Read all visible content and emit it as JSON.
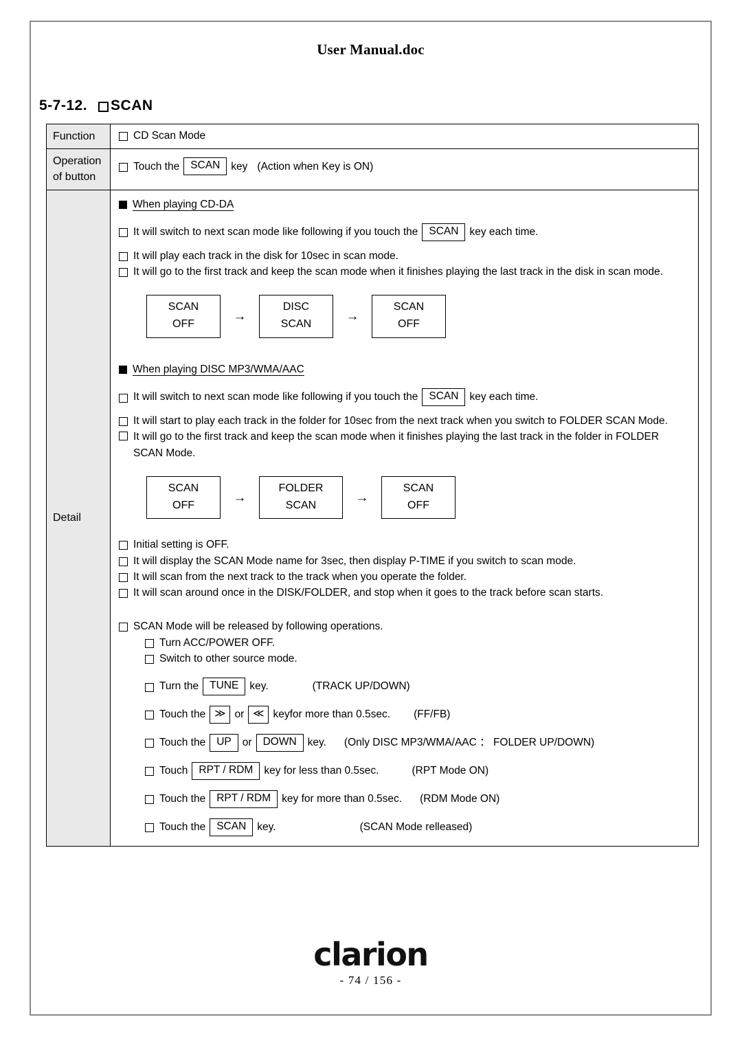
{
  "header": {
    "title": "User Manual.doc"
  },
  "section": {
    "number": "5-7-12.",
    "title": "SCAN"
  },
  "table": {
    "labels": {
      "function": "Function",
      "operation_line1": "Operation",
      "operation_line2": "of button",
      "detail": "Detail"
    },
    "function_row": {
      "text": "CD Scan Mode"
    },
    "operation_row": {
      "prefix": "Touch the",
      "key": "SCAN",
      "suffix": "key",
      "note": "(Action when Key is ON)"
    },
    "detail": {
      "cdda": {
        "heading": "When playing CD-DA",
        "b1_pre": "It will switch to next scan mode like following if you touch the",
        "b1_key": "SCAN",
        "b1_post": "key each time.",
        "b2": "It will play each track in the disk for 10sec in scan mode.",
        "b3": "It will go to the first track and keep the scan mode when it finishes playing the last track in the disk in scan mode.",
        "flow": [
          {
            "line1": "SCAN",
            "line2": "OFF"
          },
          {
            "line1": "DISC",
            "line2": "SCAN"
          },
          {
            "line1": "SCAN",
            "line2": "OFF"
          }
        ],
        "arrow": "→"
      },
      "mp3": {
        "heading": "When playing DISC MP3/WMA/AAC",
        "b1_pre": "It will switch to next scan mode like following if you touch the",
        "b1_key": "SCAN",
        "b1_post": "key each time.",
        "b2": "It will start to play each track in the folder for 10sec from the next track when you switch to FOLDER SCAN Mode.",
        "b3": "It will go to the first track and keep the scan mode when it finishes playing the last track in the folder in FOLDER SCAN Mode.",
        "flow": [
          {
            "line1": "SCAN",
            "line2": "OFF"
          },
          {
            "line1": "FOLDER",
            "line2": "SCAN"
          },
          {
            "line1": "SCAN",
            "line2": "OFF"
          }
        ],
        "arrow": "→"
      },
      "notes": [
        "Initial setting is OFF.",
        "It will display the SCAN Mode name for 3sec, then display P-TIME if you switch to scan mode.",
        "It will scan from the next track to the track when you operate the folder.",
        "It will scan around once in the DISK/FOLDER, and stop when it goes to the track before scan starts."
      ],
      "release": {
        "heading": "SCAN Mode will be released by following operations.",
        "simple": [
          "Turn ACC/POWER OFF.",
          "Switch to other source mode."
        ],
        "keyed": [
          {
            "pre": "Turn the",
            "keys": [
              "TUNE"
            ],
            "mid": "",
            "post": "key.",
            "note": "(TRACK UP/DOWN)"
          },
          {
            "pre": "Touch the",
            "keys": [
              "≫",
              "≪"
            ],
            "mid": "or",
            "post": "keyfor more than 0.5sec.",
            "note": "(FF/FB)"
          },
          {
            "pre": "Touch the",
            "keys": [
              "UP",
              "DOWN"
            ],
            "mid": "or",
            "post": "key.",
            "note": "(Only DISC MP3/WMA/AAC ： FOLDER UP/DOWN)"
          },
          {
            "pre": "Touch",
            "keys": [
              "RPT / RDM"
            ],
            "mid": "",
            "post": "key for less than 0.5sec.",
            "note": "(RPT Mode ON)"
          },
          {
            "pre": "Touch the",
            "keys": [
              "RPT / RDM"
            ],
            "mid": "",
            "post": "key for more than 0.5sec.",
            "note": "(RDM Mode ON)"
          },
          {
            "pre": "Touch the",
            "keys": [
              "SCAN"
            ],
            "mid": "",
            "post": "key.",
            "note": "(SCAN Mode relleased)"
          }
        ]
      }
    }
  },
  "footer": {
    "logo": "clarion",
    "page": "- 74 / 156 -"
  }
}
